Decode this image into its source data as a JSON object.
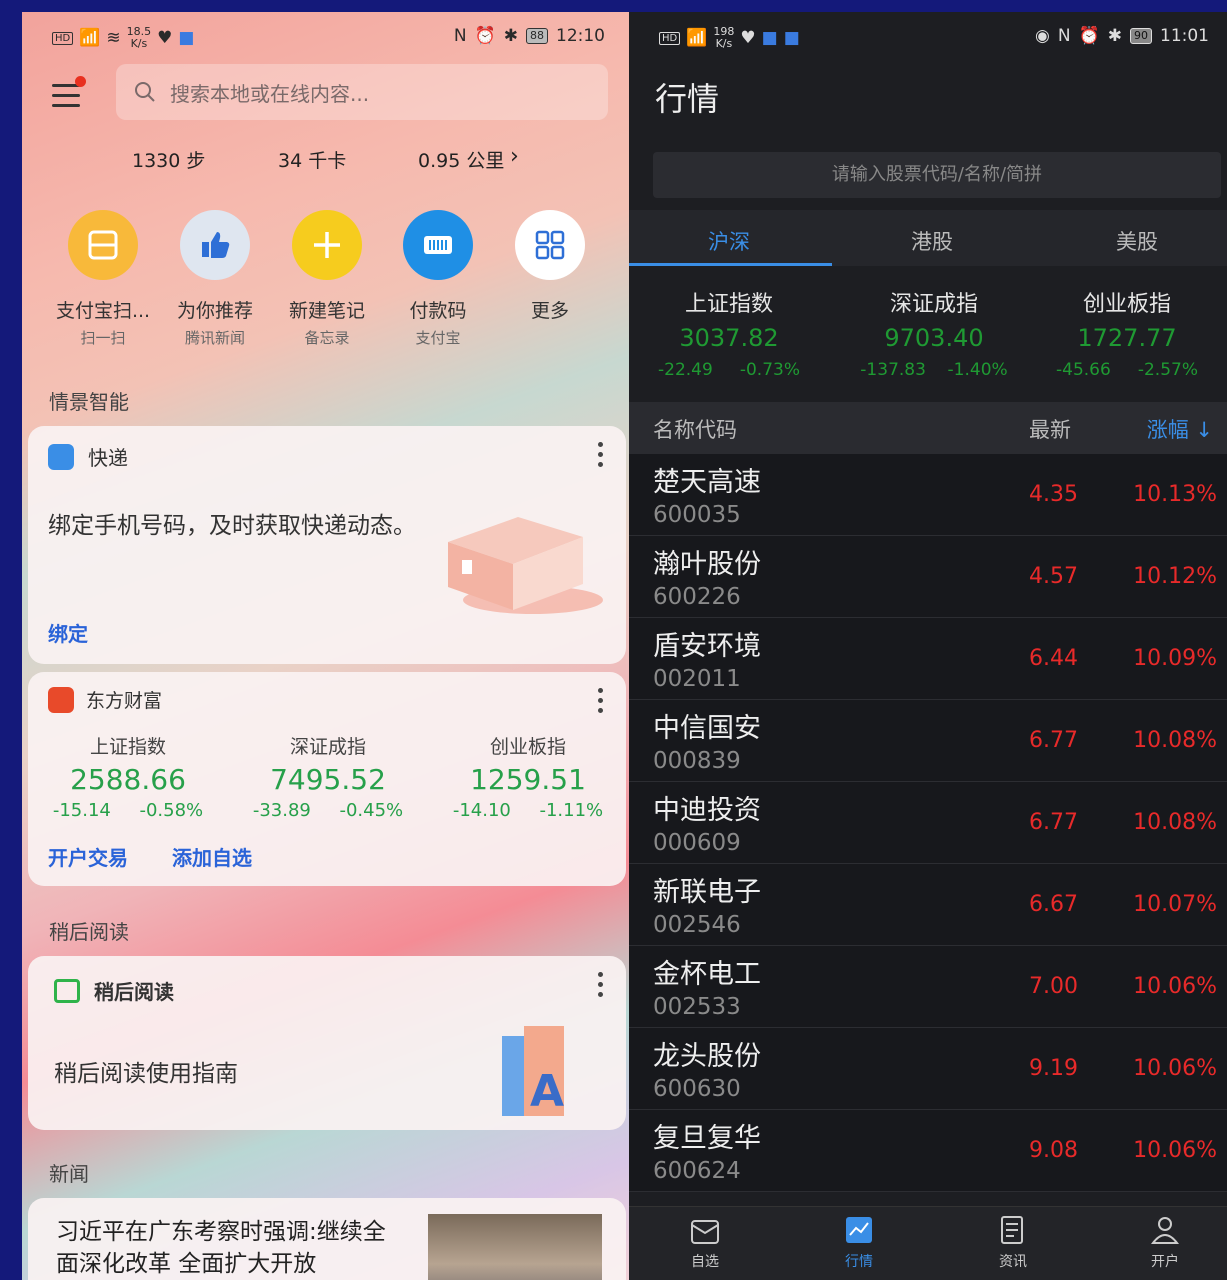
{
  "left": {
    "status": {
      "net_speed": "18.5",
      "net_unit": "K/s",
      "battery": "88",
      "time": "12:10"
    },
    "search": {
      "placeholder": "搜索本地或在线内容..."
    },
    "stats": {
      "steps": "1330 步",
      "calories": "34 千卡",
      "distance": "0.95 公里"
    },
    "quick_actions": [
      {
        "title": "支付宝扫...",
        "sub": "扫一扫",
        "icon": "scan-icon",
        "color": "#f8b93a"
      },
      {
        "title": "为你推荐",
        "sub": "腾讯新闻",
        "icon": "thumbs-up-icon",
        "color": "#dfe6f0"
      },
      {
        "title": "新建笔记",
        "sub": "备忘录",
        "icon": "plus-icon",
        "color": "#f6cc1e"
      },
      {
        "title": "付款码",
        "sub": "支付宝",
        "icon": "barcode-icon",
        "color": "#1f8fe5"
      },
      {
        "title": "更多",
        "sub": "",
        "icon": "grid-icon",
        "color": "#ffffff"
      }
    ],
    "section_scene": "情景智能",
    "express": {
      "title": "快递",
      "text": "绑定手机号码，及时获取快递动态。",
      "action": "绑定"
    },
    "stock_card": {
      "title": "东方财富",
      "indices": [
        {
          "name": "上证指数",
          "value": "2588.66",
          "change": "-15.14",
          "pct": "-0.58%"
        },
        {
          "name": "深证成指",
          "value": "7495.52",
          "change": "-33.89",
          "pct": "-0.45%"
        },
        {
          "name": "创业板指",
          "value": "1259.51",
          "change": "-14.10",
          "pct": "-1.11%"
        }
      ],
      "action1": "开户交易",
      "action2": "添加自选"
    },
    "section_later": "稍后阅读",
    "later_card": {
      "title": "稍后阅读",
      "text": "稍后阅读使用指南"
    },
    "section_news": "新闻",
    "news": {
      "headline": "习近平在广东考察时强调:继续全面深化改革 全面扩大开放"
    }
  },
  "right": {
    "status": {
      "net_speed": "198",
      "net_unit": "K/s",
      "battery": "90",
      "time": "11:01"
    },
    "title": "行情",
    "search_placeholder": "请输入股票代码/名称/简拼",
    "tabs": [
      "沪深",
      "港股",
      "美股"
    ],
    "indices": [
      {
        "name": "上证指数",
        "value": "3037.82",
        "change": "-22.49",
        "pct": "-0.73%"
      },
      {
        "name": "深证成指",
        "value": "9703.40",
        "change": "-137.83",
        "pct": "-1.40%"
      },
      {
        "name": "创业板指",
        "value": "1727.77",
        "change": "-45.66",
        "pct": "-2.57%"
      }
    ],
    "columns": {
      "name": "名称代码",
      "latest": "最新",
      "change": "涨幅 ↓"
    },
    "stocks": [
      {
        "name": "楚天高速",
        "code": "600035",
        "price": "4.35",
        "pct": "10.13%"
      },
      {
        "name": "瀚叶股份",
        "code": "600226",
        "price": "4.57",
        "pct": "10.12%"
      },
      {
        "name": "盾安环境",
        "code": "002011",
        "price": "6.44",
        "pct": "10.09%"
      },
      {
        "name": "中信国安",
        "code": "000839",
        "price": "6.77",
        "pct": "10.08%"
      },
      {
        "name": "中迪投资",
        "code": "000609",
        "price": "6.77",
        "pct": "10.08%"
      },
      {
        "name": "新联电子",
        "code": "002546",
        "price": "6.67",
        "pct": "10.07%"
      },
      {
        "name": "金杯电工",
        "code": "002533",
        "price": "7.00",
        "pct": "10.06%"
      },
      {
        "name": "龙头股份",
        "code": "600630",
        "price": "9.19",
        "pct": "10.06%"
      },
      {
        "name": "复旦复华",
        "code": "600624",
        "price": "9.08",
        "pct": "10.06%"
      }
    ],
    "nav": [
      "自选",
      "行情",
      "资讯",
      "开户"
    ]
  }
}
